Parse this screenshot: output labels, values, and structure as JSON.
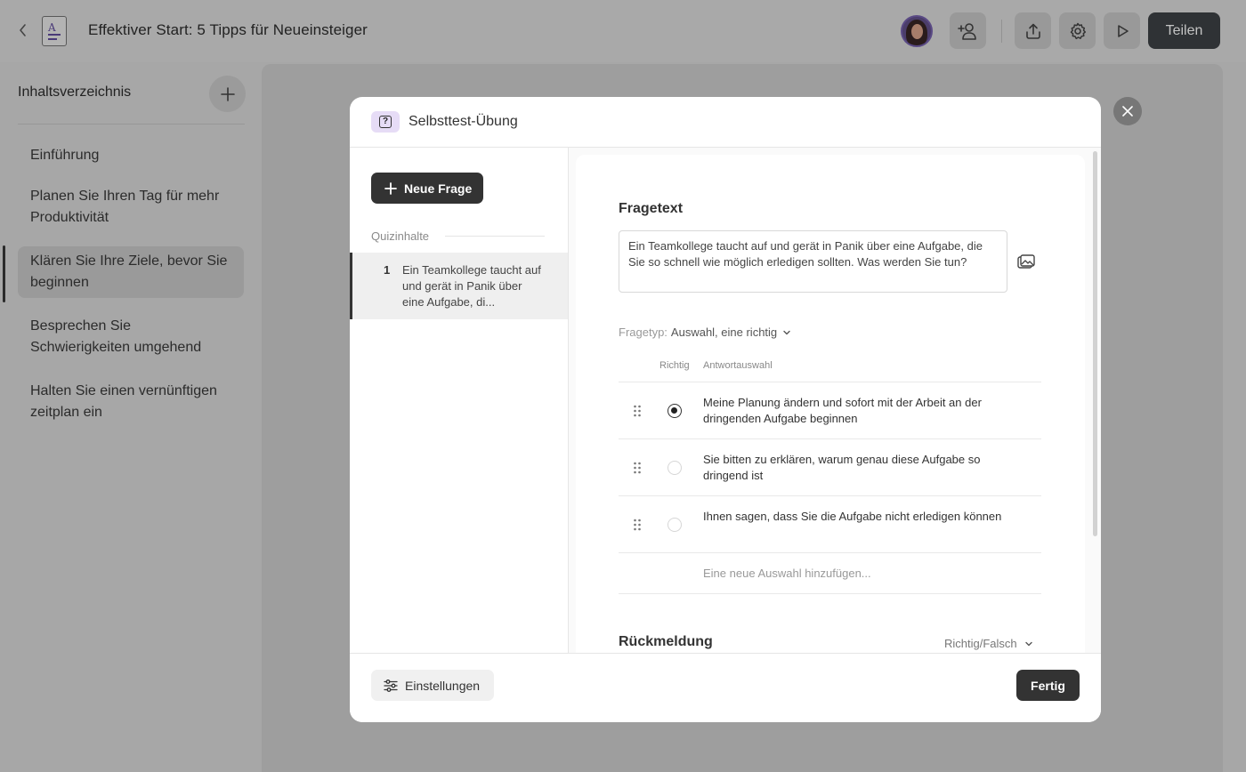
{
  "header": {
    "title": "Effektiver Start: 5 Tipps für Neueinsteiger",
    "share_label": "Teilen"
  },
  "sidebar": {
    "title": "Inhaltsverzeichnis",
    "items": [
      {
        "label": "Einführung"
      },
      {
        "label": "Planen Sie Ihren Tag für mehr Produktivität"
      },
      {
        "label": "Klären Sie Ihre Ziele, bevor Sie beginnen"
      },
      {
        "label": "Besprechen Sie Schwierigkeiten umgehend"
      },
      {
        "label": "Halten Sie einen vernünftigen zeitplan ein"
      }
    ],
    "active_index": 2
  },
  "modal": {
    "title": "Selbsttest-Übung",
    "new_question_label": "Neue Frage",
    "quiz_contents_label": "Quizinhalte",
    "questions": [
      {
        "number": "1",
        "preview": "Ein Teamkollege taucht auf und gerät in Panik über eine Aufgabe, di..."
      }
    ],
    "question_text_label": "Fragetext",
    "question_text": "Ein Teamkollege taucht auf und gerät in Panik über eine Aufgabe, die Sie so schnell wie möglich erledigen sollten. Was werden Sie tun?",
    "question_type_label": "Fragetyp:",
    "question_type_value": "Auswahl, eine richtig",
    "col_correct": "Richtig",
    "col_answer": "Antwortauswahl",
    "answers": [
      {
        "text": "Meine Planung ändern und sofort mit der Arbeit an der dringenden Aufgabe beginnen",
        "correct": true
      },
      {
        "text": "Sie bitten zu erklären, warum genau diese Aufgabe so dringend ist",
        "correct": false
      },
      {
        "text": "Ihnen sagen, dass Sie die Aufgabe nicht erledigen können",
        "correct": false
      }
    ],
    "add_choice_placeholder": "Eine neue Auswahl hinzufügen...",
    "feedback_label": "Rückmeldung",
    "feedback_value": "Richtig/Falsch",
    "settings_label": "Einstellungen",
    "done_label": "Fertig"
  },
  "colors": {
    "primary_dark": "#333333",
    "quiz_icon_bg": "#e6dcf6",
    "overlay_gray": "#a7a7a7"
  },
  "icons": {
    "back": "chevron-left-icon",
    "document": "document-icon",
    "add_user": "add-user-icon",
    "upload": "upload-icon",
    "settings": "gear-icon",
    "play": "play-icon",
    "close": "close-icon",
    "add": "plus-icon",
    "image": "image-icon",
    "drag": "drag-handle-icon",
    "chevron_down": "chevron-down-icon",
    "sliders": "sliders-icon"
  }
}
